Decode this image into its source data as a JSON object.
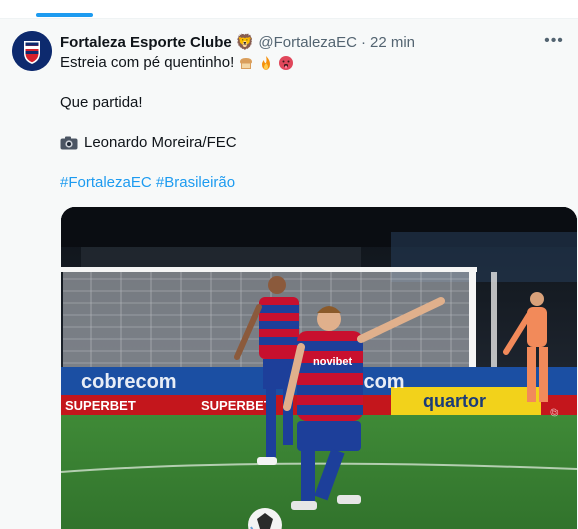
{
  "tweet": {
    "display_name": "Fortaleza Esporte Clube",
    "verified_emoji": "🦁",
    "handle": "@FortalezaEC",
    "separator": "·",
    "time": "22 min",
    "more_label": "•••",
    "line1_text": "Estreia com pé quentinho!",
    "line1_emojis": [
      "🍞",
      "🔥",
      "🥵"
    ],
    "line2_text": "Que partida!",
    "line3_icon": "camera-icon",
    "line3_text": "Leonardo Moreira/FEC",
    "hashtags": [
      "#FortalezaEC",
      "#Brasileirão"
    ]
  },
  "media": {
    "description_icon": "photo",
    "board_texts": [
      "cobrecom",
      "SUPERBET",
      "SUPERBET",
      "quartor",
      "cobrecom"
    ],
    "shirt_sponsor": "novibet"
  },
  "colors": {
    "accent": "#1d9bf0",
    "text": "#0f1419",
    "muted": "#536471",
    "background": "#f7f9f9",
    "avatar": "#0d2a6e"
  }
}
